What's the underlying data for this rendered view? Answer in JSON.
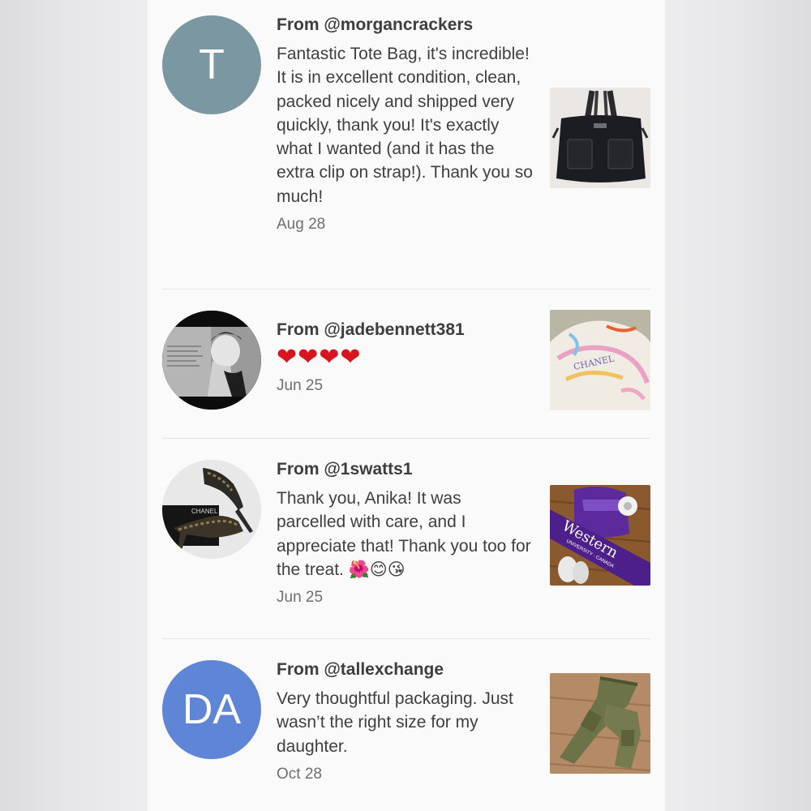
{
  "reviews": [
    {
      "author": "From @morgancrackers",
      "avatar_letters": "T",
      "avatar_color": "#7a97a2",
      "text": "Fantastic Tote Bag, it's incredible! It is in excellent condition, clean, packed nicely and shipped very quickly, thank you! It's exactly what I wanted (and it has the extra clip on strap!). Thank you so much!",
      "date": "Aug 28",
      "thumbnail": "black-tote-bag-photo"
    },
    {
      "author": "From @jadebennett381",
      "avatar": "black-and-white-portrait-photo",
      "text": "❤❤❤❤",
      "date": "Jun 25",
      "thumbnail": "silk-scarf-photo"
    },
    {
      "author": "From @1swatts1",
      "avatar": "heels-and-chanel-box-photo",
      "text": "Thank you, Anika! It was parcelled with care, and I appreciate that! Thank you too for the treat. 🌺😊😘",
      "date": "Jun 25",
      "thumbnail": "purple-western-scarf-photo"
    },
    {
      "author": "From @tallexchange",
      "avatar_letters": "DA",
      "avatar_color": "#5f85d6",
      "text": "Very thoughtful packaging. Just wasn’t the right size for my daughter.",
      "date": "Oct 28",
      "thumbnail": "olive-cargo-pants-photo"
    }
  ],
  "thumbnail_texts": {
    "scarf_print": "CHANEL",
    "western_scarf": "Western",
    "western_scarf_sub": "UNIVERSITY · CANADA",
    "shoe_box": "CHANEL"
  }
}
